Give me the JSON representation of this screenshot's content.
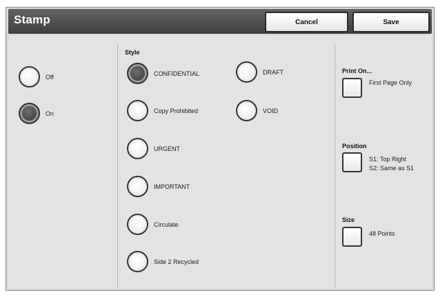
{
  "header": {
    "title": "Stamp",
    "cancel_label": "Cancel",
    "save_label": "Save"
  },
  "stamp": {
    "options": [
      {
        "label": "Off",
        "selected": false
      },
      {
        "label": "On",
        "selected": true
      }
    ]
  },
  "style": {
    "label": "Style",
    "options": [
      {
        "label": "CONFIDENTIAL",
        "selected": true
      },
      {
        "label": "Copy Prohibited",
        "selected": false
      },
      {
        "label": "URGENT",
        "selected": false
      },
      {
        "label": "IMPORTANT",
        "selected": false
      },
      {
        "label": "Circulate",
        "selected": false
      },
      {
        "label": "Side 2 Recycled",
        "selected": false
      },
      {
        "label": "DRAFT",
        "selected": false
      },
      {
        "label": "VOID",
        "selected": false
      }
    ]
  },
  "print_on": {
    "label": "Print On...",
    "value": "First Page Only"
  },
  "position": {
    "label": "Position",
    "value_line1": "S1: Top Right",
    "value_line2": "S2: Same as S1"
  },
  "size": {
    "label": "Size",
    "value": "48 Points"
  }
}
